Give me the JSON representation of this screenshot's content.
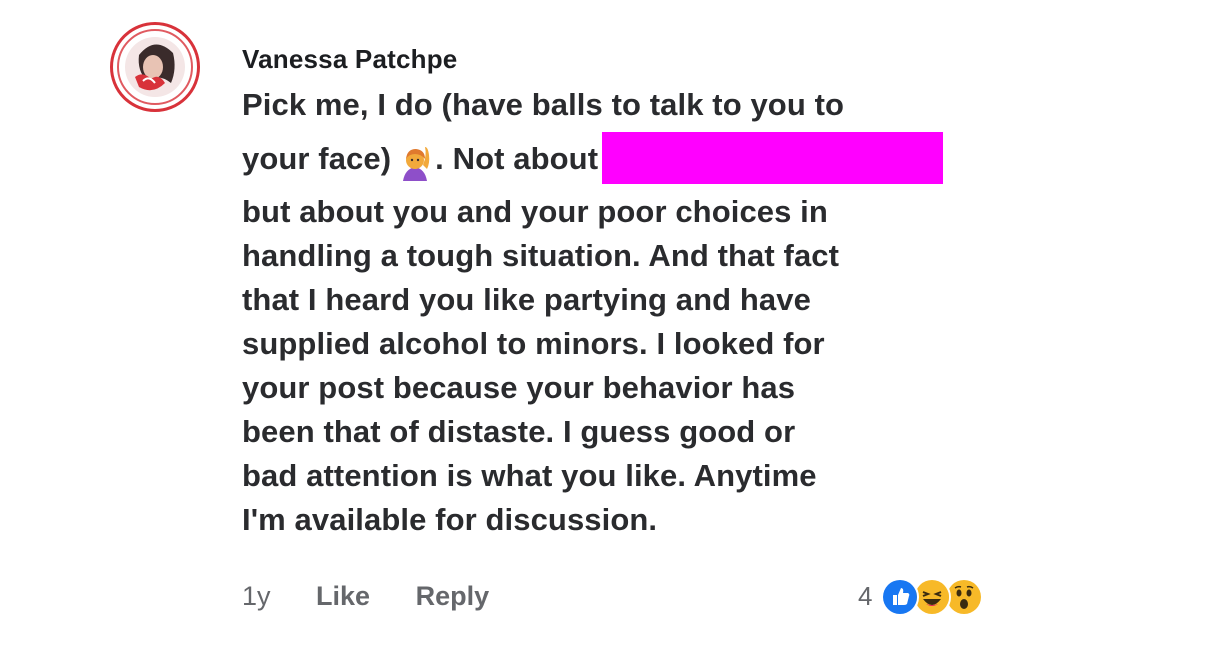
{
  "comment": {
    "author": "Vanessa Patchpe",
    "text_lines": [
      "Pick me, I do (have balls to talk to you to",
      "your face)",
      ". Not about",
      "but about you and your poor choices in",
      "handling a tough situation. And that fact",
      "that I heard you like partying and have",
      "supplied alcohol to minors. I looked for",
      "your post because your behavior has",
      "been that of distaste. I guess good or",
      "bad attention is what you like. Anytime",
      "I'm available for discussion."
    ],
    "inline_emoji": "person-raising-hand-icon",
    "redaction_color": "#ff00ff"
  },
  "footer": {
    "age": "1y",
    "like_label": "Like",
    "reply_label": "Reply"
  },
  "reactions": {
    "count": "4",
    "icons": [
      "like-reaction-icon",
      "haha-reaction-icon",
      "wow-reaction-icon"
    ],
    "colors": {
      "like": "#1877f2",
      "emoji": "#f7b928"
    }
  },
  "colors": {
    "text": "#2a2b2e",
    "muted": "#65676b",
    "avatar_ring": "#d8323a"
  }
}
